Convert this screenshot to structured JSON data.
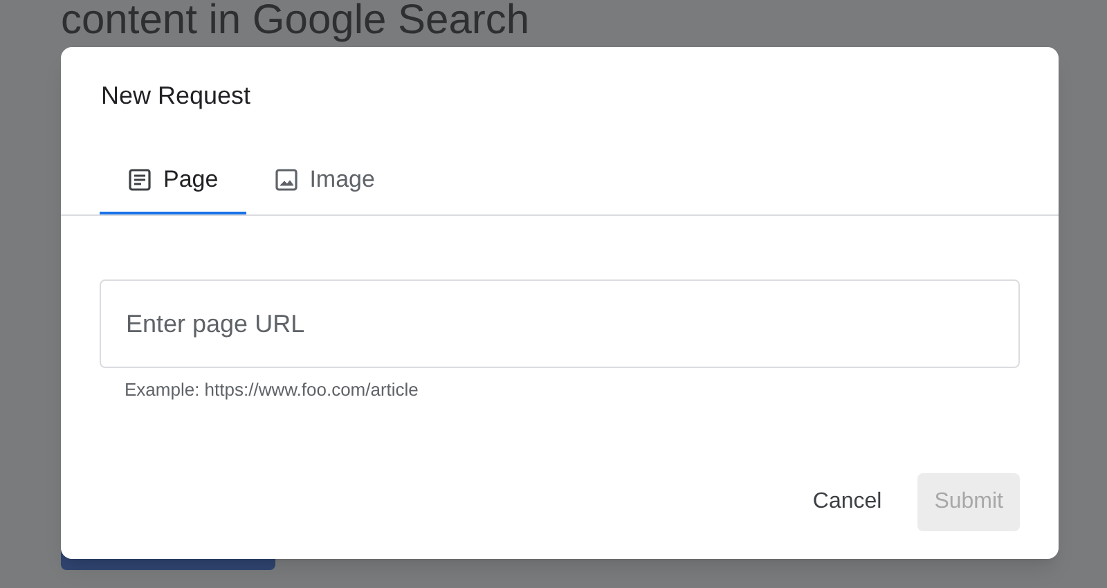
{
  "background": {
    "heading": "content in Google Search"
  },
  "dialog": {
    "title": "New Request",
    "tabs": [
      {
        "label": "Page",
        "kind": "page",
        "selected": true
      },
      {
        "label": "Image",
        "kind": "image",
        "selected": false
      }
    ],
    "url_field": {
      "placeholder": "Enter page URL",
      "helper": "Example: https://www.foo.com/article"
    },
    "buttons": [
      {
        "label": "Cancel",
        "kind": "text",
        "disabled": false
      },
      {
        "label": "Submit",
        "kind": "filled",
        "disabled": true
      }
    ]
  }
}
